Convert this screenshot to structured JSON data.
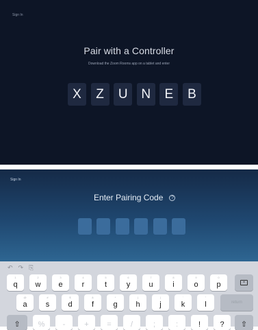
{
  "top_screen": {
    "sign_in": "Sign In",
    "title": "Pair with a Controller",
    "subtitle": "Download the Zoom Rooms app on a tablet and enter",
    "code_chars": [
      "X",
      "Z",
      "U",
      "N",
      "E",
      "B"
    ]
  },
  "bottom_screen": {
    "sign_in": "Sign In",
    "title": "Enter Pairing Code",
    "help_glyph": "?",
    "toolbar": {
      "undo": "↶",
      "redo": "↷",
      "paste": "⎘"
    },
    "keyboard": {
      "row1": [
        {
          "key": "q",
          "hint": "1"
        },
        {
          "key": "w",
          "hint": "2"
        },
        {
          "key": "e",
          "hint": "3"
        },
        {
          "key": "r",
          "hint": "4"
        },
        {
          "key": "t",
          "hint": "5"
        },
        {
          "key": "y",
          "hint": "6"
        },
        {
          "key": "u",
          "hint": "7"
        },
        {
          "key": "i",
          "hint": "8"
        },
        {
          "key": "o",
          "hint": "9"
        },
        {
          "key": "p",
          "hint": "0"
        }
      ],
      "row2": [
        {
          "key": "a",
          "hint": "@"
        },
        {
          "key": "s",
          "hint": "#"
        },
        {
          "key": "d",
          "hint": "$"
        },
        {
          "key": "f",
          "hint": "&"
        },
        {
          "key": "g",
          "hint": "*"
        },
        {
          "key": "h",
          "hint": "("
        },
        {
          "key": "j",
          "hint": ")"
        },
        {
          "key": "k",
          "hint": "'"
        },
        {
          "key": "l",
          "hint": "\""
        }
      ],
      "row3": [
        {
          "key": "%"
        },
        {
          "key": "-"
        },
        {
          "key": "+"
        },
        {
          "key": "="
        },
        {
          "key": "/"
        },
        {
          "key": ";"
        },
        {
          "key": ":"
        },
        {
          "key": "!"
        },
        {
          "key": "?"
        }
      ],
      "return_label": "return",
      "shift_glyph": "⇧",
      "delete_glyph": "×"
    }
  }
}
